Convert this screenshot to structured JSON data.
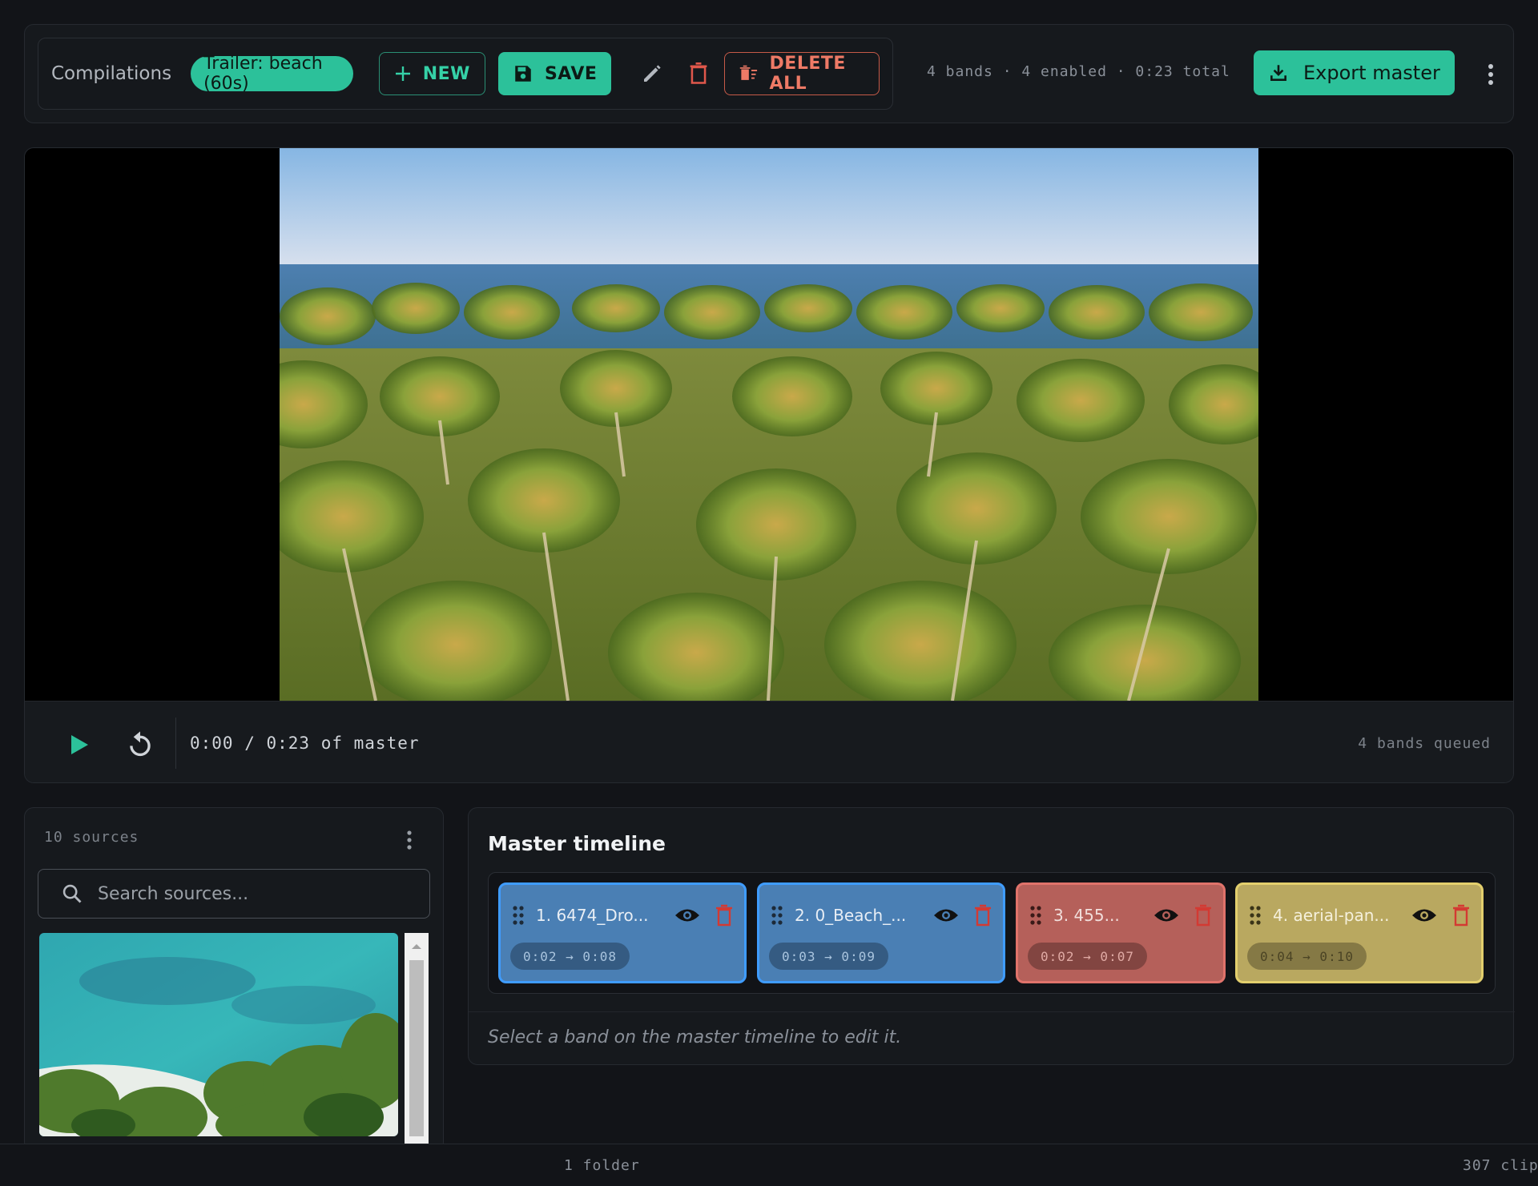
{
  "topbar": {
    "compilations_label": "Compilations",
    "active_compilation": "Trailer: beach (60s)",
    "new_label": "NEW",
    "save_label": "SAVE",
    "delete_all_label": "DELETE ALL",
    "stats": "4 bands · 4 enabled · 0:23 total",
    "export_label": "Export master"
  },
  "player": {
    "time_display": "0:00 / 0:23 of master",
    "queued": "4 bands queued"
  },
  "sources": {
    "count": "10 sources",
    "search_placeholder": "Search sources..."
  },
  "timeline": {
    "title": "Master timeline",
    "bands": [
      {
        "label": "1. 6474_Dro...",
        "range": "0:02 → 0:08",
        "color": "#4a7fb4",
        "border": "#3f9cff"
      },
      {
        "label": "2. 0_Beach_...",
        "range": "0:03 → 0:09",
        "color": "#4a7fb4",
        "border": "#3f9cff"
      },
      {
        "label": "3. 455...",
        "range": "0:02 → 0:07",
        "color": "#b5605a",
        "border": "#e0736b"
      },
      {
        "label": "4. aerial-pan...",
        "range": "0:04 → 0:10",
        "color": "#b9a860",
        "border": "#e3cf6d"
      }
    ],
    "hint": "Select a band on the master timeline to edit it."
  },
  "statusbar": {
    "folders": "1 folder",
    "clips": "307 clip"
  },
  "colors": {
    "accent": "#2cc19a",
    "danger": "#e0574b",
    "background": "#121418"
  }
}
